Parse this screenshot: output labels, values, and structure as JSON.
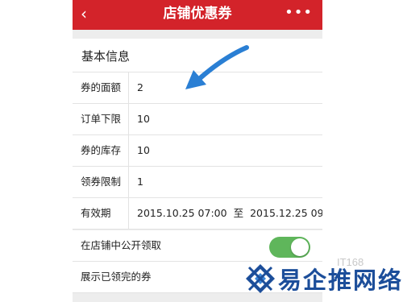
{
  "header": {
    "back_icon": "‹",
    "title": "店铺优惠券",
    "more_icon": "•••"
  },
  "section": {
    "title": "基本信息"
  },
  "fields": [
    {
      "label": "券的面额",
      "value": "2"
    },
    {
      "label": "订单下限",
      "value": "10"
    },
    {
      "label": "券的库存",
      "value": "10"
    },
    {
      "label": "领券限制",
      "value": "1"
    }
  ],
  "validity": {
    "label": "有效期",
    "start": "2015.10.25 07:00",
    "separator": "至",
    "end": "2015.12.25 09:00"
  },
  "toggles": [
    {
      "label": "在店铺中公开领取",
      "on": true
    },
    {
      "label": "展示已领完的券"
    }
  ],
  "watermark": {
    "text": "易企推网络",
    "faint": "IT168"
  },
  "colors": {
    "header": "#d3232a",
    "toggle_on": "#5fb65b",
    "arrow": "#2a7fd4",
    "watermark": "#1c4e9a"
  }
}
